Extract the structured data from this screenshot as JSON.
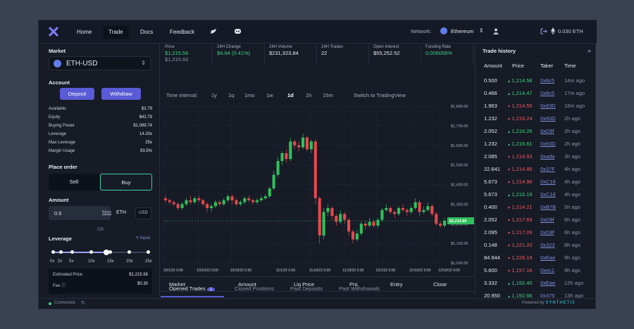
{
  "nav": {
    "home": "Home",
    "trade": "Trade",
    "docs": "Docs",
    "feedback": "Feedback",
    "network_label": "Network:",
    "network": "Ethereum",
    "balance": "0.030 ETH"
  },
  "market": {
    "title": "Market",
    "pair": "ETH-USD"
  },
  "account": {
    "title": "Account",
    "deposit": "Deposit",
    "withdraw": "Withdraw",
    "stats": [
      {
        "label": "Available:",
        "value": "$2.79"
      },
      {
        "label": "Equity",
        "value": "$42.79"
      },
      {
        "label": "Buying Power",
        "value": "$1,069.74"
      },
      {
        "label": "Leverage",
        "value": "14.20x"
      },
      {
        "label": "Max Leverage",
        "value": "25x"
      },
      {
        "label": "Margin Usage",
        "value": "93.5%"
      }
    ]
  },
  "order": {
    "title": "Place order",
    "sell": "Sell",
    "buy": "Buy",
    "amount_title": "Amount",
    "amount": "0.5",
    "max": "Max",
    "unit": "ETH",
    "alt_unit": "USD",
    "or": "OR",
    "leverage_title": "Leverage",
    "input_link": "Input",
    "ticks": [
      "0x",
      "2x",
      "5x",
      "10x",
      "15x",
      "20x",
      "25x"
    ],
    "leverage_level": 0.56,
    "est_label": "Estimated Price",
    "est_value": "$1,215.56",
    "fee_label": "Fee",
    "fee_value": "$0.30"
  },
  "header": [
    {
      "label": "Price",
      "value": "$1,215.56",
      "sub": "$1,215.60",
      "color": "#3ed07c"
    },
    {
      "label": "24H Change",
      "value": "$4.94 (0.41%)",
      "color": "#3ed07c"
    },
    {
      "label": "24H Volume",
      "value": "$231,323.84"
    },
    {
      "label": "24H Trades",
      "value": "22"
    },
    {
      "label": "Open Interest",
      "value": "$55,252.52"
    },
    {
      "label": "Funding Rate",
      "value": "0.006056%",
      "color": "#3ed07c"
    }
  ],
  "timeframe": {
    "label": "Time interval:",
    "options": [
      "1y",
      "1q",
      "1mo",
      "1w",
      "1d",
      "1h",
      "15m"
    ],
    "active": "1d",
    "switch": "Switch to TradingView"
  },
  "chart_data": {
    "type": "candlestick",
    "y_ticks": [
      "$1,800.00",
      "$1,700.00",
      "$1,600.00",
      "$1,500.00",
      "$1,400.00",
      "$1,300.00",
      "$1,200.00",
      "$1,100.00",
      "$1,000.00"
    ],
    "x_ticks": [
      "10/1/22 0:00",
      "10/10/22 0:00",
      "10/19/22 0:00",
      "11/1/22 0:00",
      "11/10/22 0:00",
      "11/19/22 0:00",
      "12/1/22 0:00",
      "12/10/22 0:00",
      "12/19/22 0:00"
    ],
    "ylim": [
      1000,
      1800
    ],
    "last_price": "$1,214.89",
    "candles": [
      [
        1330,
        1320,
        1345,
        1310
      ],
      [
        1320,
        1310,
        1330,
        1300
      ],
      [
        1310,
        1300,
        1320,
        1290
      ],
      [
        1300,
        1280,
        1310,
        1270
      ],
      [
        1280,
        1300,
        1310,
        1270
      ],
      [
        1300,
        1320,
        1330,
        1290
      ],
      [
        1320,
        1310,
        1340,
        1300
      ],
      [
        1310,
        1330,
        1340,
        1300
      ],
      [
        1330,
        1320,
        1345,
        1310
      ],
      [
        1320,
        1300,
        1330,
        1290
      ],
      [
        1300,
        1280,
        1310,
        1260
      ],
      [
        1280,
        1290,
        1300,
        1260
      ],
      [
        1290,
        1310,
        1320,
        1280
      ],
      [
        1310,
        1300,
        1320,
        1290
      ],
      [
        1300,
        1320,
        1330,
        1290
      ],
      [
        1320,
        1340,
        1350,
        1310
      ],
      [
        1340,
        1320,
        1350,
        1300
      ],
      [
        1320,
        1300,
        1330,
        1290
      ],
      [
        1300,
        1310,
        1320,
        1290
      ],
      [
        1310,
        1330,
        1340,
        1300
      ],
      [
        1330,
        1320,
        1345,
        1310
      ],
      [
        1320,
        1310,
        1330,
        1300
      ],
      [
        1310,
        1320,
        1330,
        1300
      ],
      [
        1320,
        1330,
        1345,
        1310
      ],
      [
        1330,
        1340,
        1350,
        1320
      ],
      [
        1340,
        1380,
        1390,
        1330
      ],
      [
        1380,
        1450,
        1470,
        1370
      ],
      [
        1450,
        1520,
        1540,
        1440
      ],
      [
        1520,
        1560,
        1570,
        1500
      ],
      [
        1560,
        1530,
        1580,
        1510
      ],
      [
        1530,
        1620,
        1640,
        1520
      ],
      [
        1620,
        1600,
        1630,
        1580
      ],
      [
        1600,
        1590,
        1620,
        1570
      ],
      [
        1590,
        1640,
        1660,
        1580
      ],
      [
        1640,
        1580,
        1650,
        1570
      ],
      [
        1580,
        1620,
        1630,
        1560
      ],
      [
        1620,
        1330,
        1630,
        1300
      ],
      [
        1330,
        1140,
        1340,
        1100
      ],
      [
        1140,
        1260,
        1280,
        1120
      ],
      [
        1260,
        1280,
        1300,
        1240
      ],
      [
        1280,
        1240,
        1290,
        1220
      ],
      [
        1240,
        1210,
        1250,
        1190
      ],
      [
        1210,
        1250,
        1270,
        1200
      ],
      [
        1250,
        1220,
        1260,
        1200
      ],
      [
        1220,
        1160,
        1230,
        1140
      ],
      [
        1160,
        1120,
        1170,
        1100
      ],
      [
        1120,
        1150,
        1170,
        1110
      ],
      [
        1150,
        1200,
        1210,
        1140
      ],
      [
        1200,
        1190,
        1215,
        1170
      ],
      [
        1190,
        1210,
        1230,
        1180
      ],
      [
        1210,
        1190,
        1220,
        1180
      ],
      [
        1190,
        1220,
        1230,
        1180
      ],
      [
        1220,
        1270,
        1280,
        1210
      ],
      [
        1270,
        1280,
        1300,
        1260
      ],
      [
        1280,
        1260,
        1290,
        1250
      ],
      [
        1260,
        1250,
        1270,
        1230
      ],
      [
        1250,
        1280,
        1290,
        1240
      ],
      [
        1280,
        1270,
        1300,
        1260
      ],
      [
        1270,
        1260,
        1280,
        1240
      ],
      [
        1260,
        1280,
        1290,
        1250
      ],
      [
        1280,
        1310,
        1330,
        1270
      ],
      [
        1310,
        1260,
        1320,
        1240
      ],
      [
        1260,
        1270,
        1290,
        1250
      ],
      [
        1270,
        1290,
        1310,
        1260
      ],
      [
        1290,
        1250,
        1300,
        1240
      ],
      [
        1250,
        1200,
        1260,
        1190
      ],
      [
        1200,
        1190,
        1210,
        1180
      ],
      [
        1190,
        1215,
        1230,
        1180
      ]
    ]
  },
  "tabs": {
    "opened": "Opened Trades",
    "opened_count": "1",
    "closed": "Closed Positions",
    "deposits": "Past Deposits",
    "withdrawals": "Past Withdrawals"
  },
  "columns": [
    "Market",
    "Amount",
    "Liq Price",
    "PnL",
    "Entry",
    "Close"
  ],
  "history": {
    "title": "Trade history",
    "headers": [
      "Amount",
      "Price",
      "Taker",
      "Time"
    ],
    "rows": [
      {
        "amount": "0.500",
        "price": "1,214.58",
        "dir": "up",
        "taker": "0x8c5",
        "time": "14m ago"
      },
      {
        "amount": "0.466",
        "price": "1,214.47",
        "dir": "up",
        "taker": "0x8c5",
        "time": "17m ago"
      },
      {
        "amount": "1.963",
        "price": "1,214.55",
        "dir": "dn",
        "taker": "0x93D",
        "time": "18m ago"
      },
      {
        "amount": "1.232",
        "price": "1,216.24",
        "dir": "dn",
        "taker": "0x93D",
        "time": "2h ago"
      },
      {
        "amount": "2.052",
        "price": "1,216.26",
        "dir": "up",
        "taker": "0xD9f",
        "time": "2h ago"
      },
      {
        "amount": "1.232",
        "price": "1,216.61",
        "dir": "up",
        "taker": "0x93D",
        "time": "2h ago"
      },
      {
        "amount": "2.085",
        "price": "1,214.93",
        "dir": "dn",
        "taker": "0xada",
        "time": "3h ago"
      },
      {
        "amount": "22.641",
        "price": "1,214.88",
        "dir": "dn",
        "taker": "0x37F",
        "time": "4h ago"
      },
      {
        "amount": "5.673",
        "price": "1,214.96",
        "dir": "dn",
        "taker": "0xC18",
        "time": "4h ago"
      },
      {
        "amount": "5.673",
        "price": "1,216.19",
        "dir": "up",
        "taker": "0xC18",
        "time": "4h ago"
      },
      {
        "amount": "0.400",
        "price": "1,214.21",
        "dir": "dn",
        "taker": "0xB7B",
        "time": "5h ago"
      },
      {
        "amount": "2.052",
        "price": "1,217.69",
        "dir": "dn",
        "taker": "0xD9f",
        "time": "6h ago"
      },
      {
        "amount": "2.095",
        "price": "1,217.09",
        "dir": "dn",
        "taker": "0xD9f",
        "time": "6h ago"
      },
      {
        "amount": "0.148",
        "price": "1,221.20",
        "dir": "dn",
        "taker": "0x323",
        "time": "8h ago"
      },
      {
        "amount": "84.944",
        "price": "1,228.19",
        "dir": "dn",
        "taker": "0xEae",
        "time": "9h ago"
      },
      {
        "amount": "5.600",
        "price": "1,197.16",
        "dir": "dn",
        "taker": "0xec1",
        "time": "9h ago"
      },
      {
        "amount": "3.332",
        "price": "1,192.40",
        "dir": "up",
        "taker": "0xEae",
        "time": "12h ago"
      },
      {
        "amount": "20.950",
        "price": "1,192.66",
        "dir": "up",
        "taker": "0x375",
        "time": "13h ago"
      }
    ]
  },
  "footer": {
    "status": "Connected.",
    "powered": "Powered by",
    "brand": "SYNTHETIX"
  }
}
